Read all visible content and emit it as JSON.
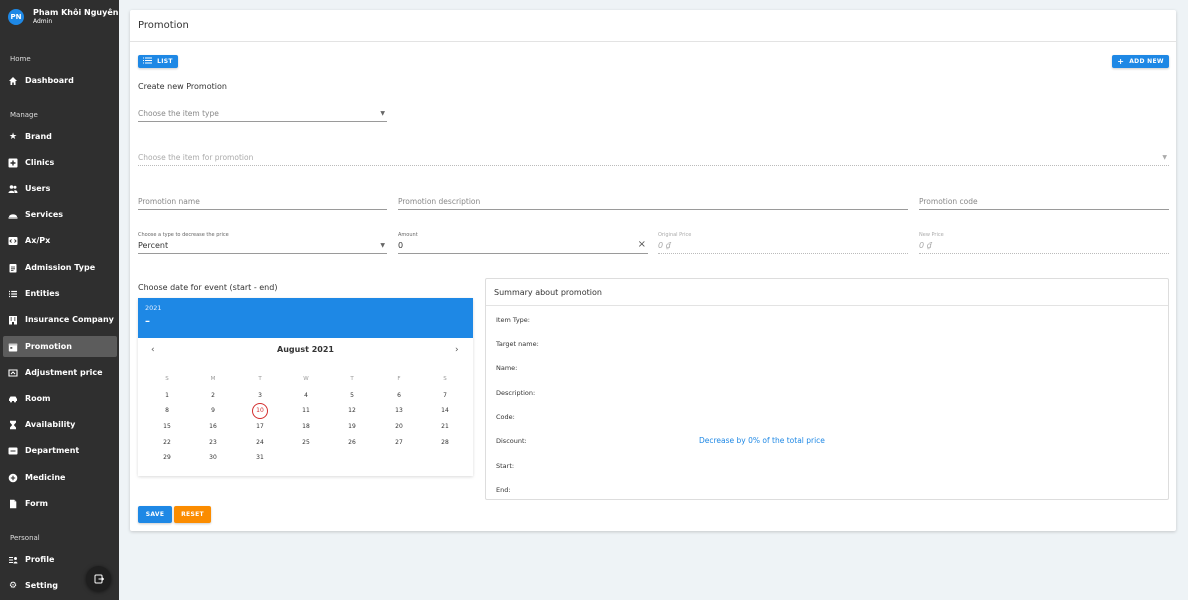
{
  "user": {
    "initials": "PN",
    "name": "Pham Khôi Nguyên",
    "role": "Admin"
  },
  "sidebar": {
    "sections": [
      {
        "label": "Home"
      },
      {
        "label": "Manage"
      },
      {
        "label": "Personal"
      }
    ],
    "items": [
      {
        "label": "Dashboard",
        "icon": "home-icon"
      },
      {
        "label": "Brand",
        "icon": "star-icon"
      },
      {
        "label": "Clinics",
        "icon": "plus-square-icon"
      },
      {
        "label": "Users",
        "icon": "users-icon"
      },
      {
        "label": "Services",
        "icon": "services-icon"
      },
      {
        "label": "Ax/Px",
        "icon": "code-icon"
      },
      {
        "label": "Admission Type",
        "icon": "clipboard-icon"
      },
      {
        "label": "Entities",
        "icon": "list-icon"
      },
      {
        "label": "Insurance Company",
        "icon": "building-icon"
      },
      {
        "label": "Promotion",
        "icon": "calendar-icon",
        "active": true
      },
      {
        "label": "Adjustment price",
        "icon": "adjust-icon"
      },
      {
        "label": "Room",
        "icon": "car-icon"
      },
      {
        "label": "Availability",
        "icon": "hourglass-icon"
      },
      {
        "label": "Department",
        "icon": "department-icon"
      },
      {
        "label": "Medicine",
        "icon": "pill-icon"
      },
      {
        "label": "Form",
        "icon": "file-icon"
      },
      {
        "label": "Profile",
        "icon": "profile-icon"
      },
      {
        "label": "Setting",
        "icon": "gear-icon"
      }
    ]
  },
  "page": {
    "title": "Promotion",
    "list_button": "LIST",
    "add_new_button": "ADD NEW",
    "subtitle": "Create new Promotion"
  },
  "form": {
    "item_type": {
      "placeholder": "Choose the item type"
    },
    "item_for_promotion": {
      "placeholder": "Choose the item for promotion"
    },
    "promotion_name": {
      "placeholder": "Promotion name"
    },
    "promotion_description": {
      "placeholder": "Promotion description"
    },
    "promotion_code": {
      "placeholder": "Promotion code"
    },
    "decrease_type": {
      "label": "Choose a type to decrease the price",
      "value": "Percent"
    },
    "amount": {
      "label": "Amount",
      "value": "0"
    },
    "original_price": {
      "label": "Original Price",
      "value": "0 ₫"
    },
    "new_price": {
      "label": "New Price",
      "value": "0 ₫"
    },
    "date_heading": "Choose date for event (start - end)"
  },
  "calendar": {
    "year": "2021",
    "selected_display": "–",
    "month": "August 2021",
    "weekdays": [
      "S",
      "M",
      "T",
      "W",
      "T",
      "F",
      "S"
    ],
    "today": "10",
    "weeks": [
      [
        "1",
        "2",
        "3",
        "4",
        "5",
        "6",
        "7"
      ],
      [
        "8",
        "9",
        "10",
        "11",
        "12",
        "13",
        "14"
      ],
      [
        "15",
        "16",
        "17",
        "18",
        "19",
        "20",
        "21"
      ],
      [
        "22",
        "23",
        "24",
        "25",
        "26",
        "27",
        "28"
      ],
      [
        "29",
        "30",
        "31",
        "",
        "",
        "",
        ""
      ]
    ]
  },
  "summary": {
    "title": "Summary about promotion",
    "labels": [
      "Item Type:",
      "Target name:",
      "Name:",
      "Description:",
      "Code:",
      "Discount:",
      "Start:",
      "End:"
    ],
    "discount_text": "Decrease by 0% of the total price"
  },
  "actions": {
    "save": "SAVE",
    "reset": "RESET"
  },
  "colors": {
    "primary": "#1e88e5",
    "accent": "#fb8c00",
    "sidebar": "#2f2f2f",
    "today": "#d32f2f"
  }
}
